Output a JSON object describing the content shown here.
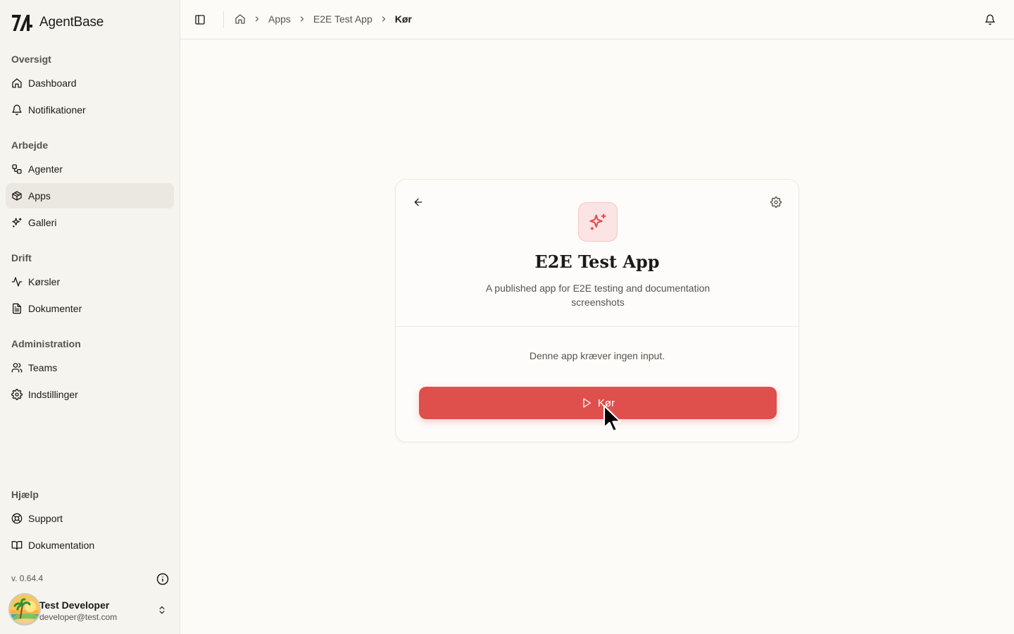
{
  "app": {
    "name": "AgentBase"
  },
  "sidebar": {
    "groups": [
      {
        "label": "Oversigt",
        "items": [
          {
            "label": "Dashboard",
            "icon": "home-icon"
          },
          {
            "label": "Notifikationer",
            "icon": "bell-icon"
          }
        ]
      },
      {
        "label": "Arbejde",
        "items": [
          {
            "label": "Agenter",
            "icon": "workflow-icon"
          },
          {
            "label": "Apps",
            "icon": "package-icon",
            "active": true
          },
          {
            "label": "Galleri",
            "icon": "sparkles-icon"
          }
        ]
      },
      {
        "label": "Drift",
        "items": [
          {
            "label": "Kørsler",
            "icon": "activity-icon"
          },
          {
            "label": "Dokumenter",
            "icon": "file-text-icon"
          }
        ]
      },
      {
        "label": "Administration",
        "items": [
          {
            "label": "Teams",
            "icon": "users-icon"
          },
          {
            "label": "Indstillinger",
            "icon": "gear-icon"
          }
        ]
      },
      {
        "label": "Hjælp",
        "items": [
          {
            "label": "Support",
            "icon": "life-buoy-icon"
          },
          {
            "label": "Dokumentation",
            "icon": "book-open-icon"
          }
        ]
      }
    ],
    "version": "v. 0.64.4",
    "user": {
      "name": "Test Developer",
      "email": "developer@test.com"
    }
  },
  "breadcrumb": {
    "items": [
      "Apps",
      "E2E Test App"
    ],
    "current": "Kør"
  },
  "card": {
    "title": "E2E Test App",
    "description": "A published app for E2E testing and documentation screenshots",
    "no_input_text": "Denne app kræver ingen input.",
    "run_label": "Kør"
  },
  "colors": {
    "accent": "#df4f4c",
    "accent_soft": "#fbe4e3",
    "sidebar_bg": "#f6f4ef",
    "page_bg": "#fcfbf8"
  }
}
